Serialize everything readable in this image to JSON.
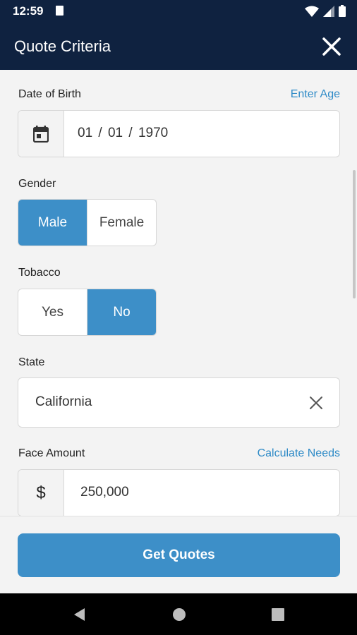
{
  "status_bar": {
    "time": "12:59"
  },
  "header": {
    "title": "Quote Criteria"
  },
  "dob": {
    "label": "Date of Birth",
    "link": "Enter Age",
    "value": "01  /  01  /  1970"
  },
  "gender": {
    "label": "Gender",
    "options": [
      "Male",
      "Female"
    ],
    "selected": "Male"
  },
  "tobacco": {
    "label": "Tobacco",
    "options": [
      "Yes",
      "No"
    ],
    "selected": "No"
  },
  "state": {
    "label": "State",
    "value": "California"
  },
  "face_amount": {
    "label": "Face Amount",
    "link": "Calculate Needs",
    "currency_symbol": "$",
    "value": "250,000"
  },
  "footer": {
    "button_label": "Get Quotes"
  },
  "colors": {
    "header_bg": "#0f2240",
    "accent": "#3d8fc8",
    "link": "#2f8bc7",
    "background": "#f3f3f3"
  }
}
